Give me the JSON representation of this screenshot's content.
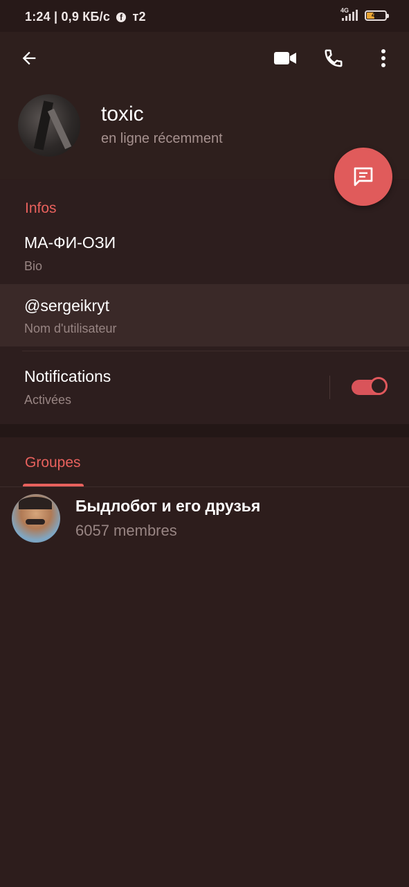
{
  "status_bar": {
    "time_and_speed": "1:24 | 0,9 КБ/с",
    "carrier": "т2",
    "network": "4G",
    "battery_level": "45"
  },
  "header": {
    "name": "toxic",
    "status": "en ligne récemment",
    "icons": [
      "back-arrow-icon",
      "video-call-icon",
      "phone-icon",
      "more-vert-icon",
      "message-icon"
    ]
  },
  "info": {
    "section_title": "Infos",
    "bio_value": "МА-ФИ-ОЗИ",
    "bio_label": "Bio",
    "username_value": "@sergeikryt",
    "username_label": "Nom d'utilisateur",
    "notifications_value": "Notifications",
    "notifications_label": "Activées",
    "notifications_enabled": true
  },
  "groups": {
    "tab_label": "Groupes",
    "items": [
      {
        "name": "Быдлобот и его друзья",
        "members": "6057 membres"
      }
    ]
  },
  "colors": {
    "accent": "#e8615d",
    "fab": "#e05b5b",
    "background": "#2d1d1c"
  }
}
